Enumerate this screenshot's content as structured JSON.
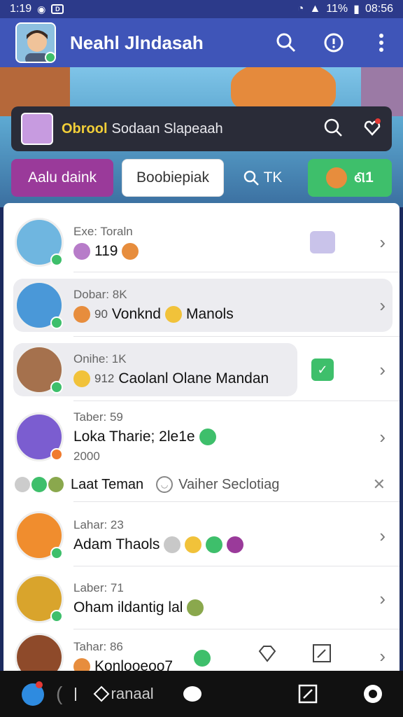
{
  "status_bar": {
    "time": "1:19",
    "battery": "11%",
    "clock": "08:56"
  },
  "app_bar": {
    "title": "Neahl Jlndasah"
  },
  "search_card": {
    "highlight": "Obrool",
    "text": "Sodaan Slapeaah"
  },
  "chips": {
    "purple": "Aalu daink",
    "white": "Boobiepiak",
    "plain": "TK",
    "green": "ଣ1"
  },
  "contacts": [
    {
      "sub": "Exe: Toraln",
      "name": "119",
      "emoji": [
        "#b77cc9",
        "#e78d3d"
      ]
    },
    {
      "sub": "Dobar: 8K",
      "name_prefix": "90",
      "name": "Vonknd",
      "name_suffix": "Manols",
      "emoji": [
        "#e78d3d",
        "#f1c23a"
      ]
    },
    {
      "sub": "Onihe: 1K",
      "name_prefix": "912",
      "name": "Caolanl Olane Mandan",
      "emoji": [
        "#f1c23a"
      ]
    },
    {
      "sub": "Taber: 59",
      "name": "Loka Tharie; 2le1e",
      "extra": "2000",
      "emoji": [
        "#3ebf6b"
      ]
    },
    {
      "sub": "Lahar: 23",
      "name": "Adam Thaols",
      "emoji": [
        "#c8c8c8",
        "#f1c23a",
        "#3ebf6b",
        "#9a3a9a"
      ]
    },
    {
      "sub": "Laber: 71",
      "name": "Oham ildantig lal",
      "emoji": [
        "#8aa84d"
      ]
    },
    {
      "sub": "Tahar: 86",
      "name": "Konlooeoo7",
      "emoji": [
        "#e78d3d",
        "#3ebf6b"
      ]
    }
  ],
  "notification": {
    "label": "Laat Teman",
    "subtext": "Vaiher Seclotiag"
  },
  "bottom_nav": {
    "label": "ranaal"
  },
  "colors": {
    "appbar": "#3f55b8",
    "accent_purple": "#9a3a9a",
    "accent_green": "#3ebf6b",
    "highlight_yellow": "#f2cf38"
  }
}
